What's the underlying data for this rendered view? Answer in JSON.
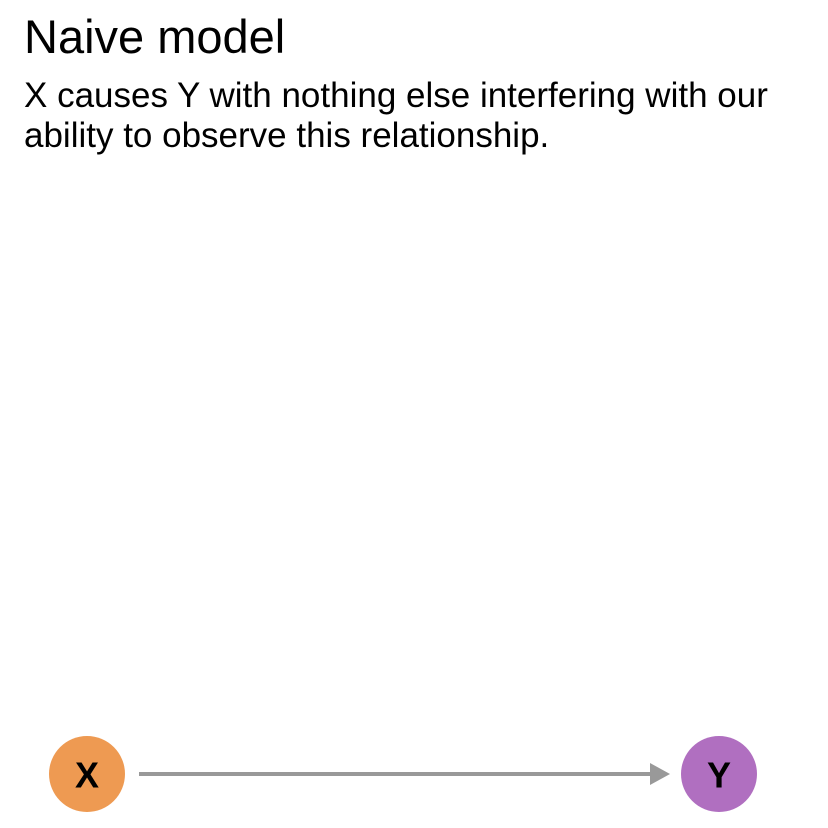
{
  "title": "Naive model",
  "subtitle": "X causes Y with nothing else interfering with our ability to observe this relationship.",
  "nodes": [
    {
      "id": "X",
      "label": "X",
      "color": "#EE9A52"
    },
    {
      "id": "Y",
      "label": "Y",
      "color": "#B06FC0"
    }
  ],
  "edges": [
    {
      "from": "X",
      "to": "Y"
    }
  ],
  "edge_color": "#999999"
}
